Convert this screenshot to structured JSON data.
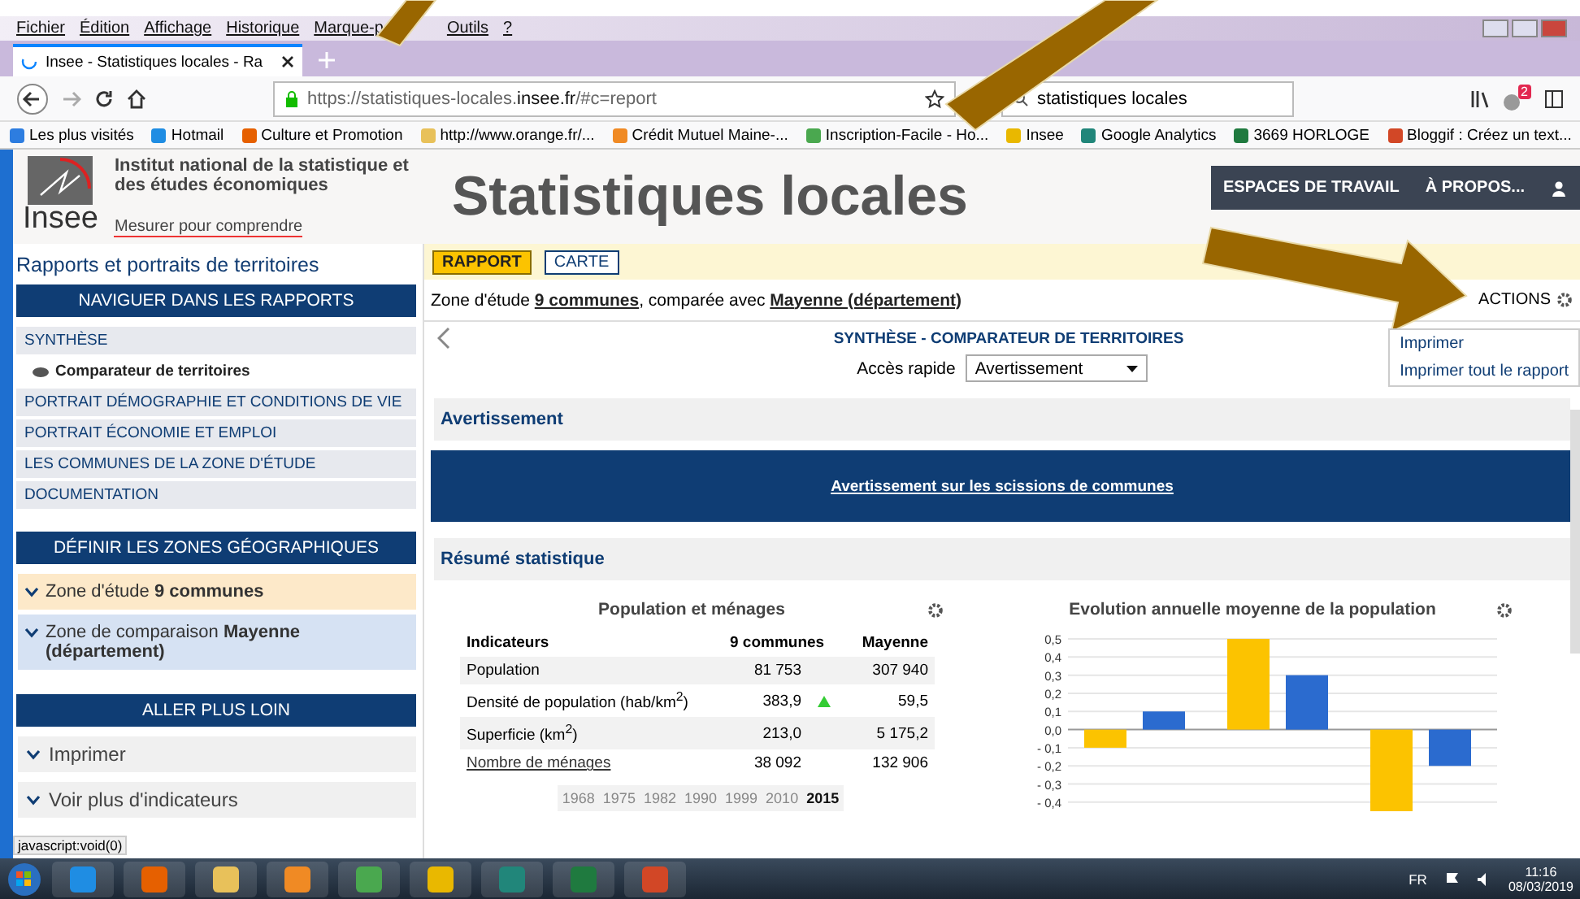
{
  "browser": {
    "menu": [
      "Fichier",
      "Édition",
      "Affichage",
      "Historique",
      "Marque-p",
      "Outils",
      "?"
    ],
    "tab_title": "Insee - Statistiques locales - Ra",
    "url": {
      "prefix": "https://statistiques-locales.",
      "domain": "insee.fr",
      "suffix": "/#c=report"
    },
    "search_value": "statistiques locales",
    "notification_count": "2",
    "bookmarks": [
      "Les plus visités",
      "Hotmail",
      "Culture et Promotion",
      "http://www.orange.fr/...",
      "Crédit Mutuel Maine-...",
      "Inscription-Facile - Ho...",
      "Insee",
      "Google Analytics",
      "3669 HORLOGE",
      "Bloggif : Créez un text..."
    ]
  },
  "header": {
    "logo_text": "Insee",
    "institute": "Institut national de la statistique et des études économiques",
    "tagline": "Mesurer pour comprendre",
    "title": "Statistiques locales",
    "nav": [
      "ESPACES DE TRAVAIL",
      "À PROPOS..."
    ]
  },
  "sidebar": {
    "title": "Rapports et portraits de territoires",
    "sections": [
      {
        "heading": "NAVIGUER DANS LES RAPPORTS",
        "kind": "links",
        "items": [
          {
            "label": "SYNTHÈSE",
            "selected": false,
            "children": [
              {
                "label": "Comparateur de territoires",
                "selected": true
              }
            ]
          },
          {
            "label": "PORTRAIT DÉMOGRAPHIE ET CONDITIONS DE VIE",
            "selected": false
          },
          {
            "label": "PORTRAIT ÉCONOMIE ET EMPLOI",
            "selected": false
          },
          {
            "label": "LES COMMUNES DE LA ZONE D'ÉTUDE",
            "selected": false
          },
          {
            "label": "DOCUMENTATION",
            "selected": false
          }
        ]
      },
      {
        "heading": "DÉFINIR LES ZONES GÉOGRAPHIQUES",
        "kind": "zones",
        "items": [
          {
            "label": "Zone d'étude **9 communes**",
            "color": "#fde9c9"
          },
          {
            "label": "Zone de comparaison **Mayenne (département)**",
            "color": "#d6e2f3"
          }
        ]
      },
      {
        "heading": "ALLER PLUS LOIN",
        "kind": "expanders",
        "items": [
          {
            "label": "Imprimer"
          },
          {
            "label": "Voir plus d'indicateurs"
          }
        ]
      }
    ]
  },
  "content": {
    "modes": [
      {
        "label": "RAPPORT",
        "selected": true
      },
      {
        "label": "CARTE",
        "selected": false
      }
    ],
    "zone_line": {
      "prefix": "Zone d'étude ",
      "study": "9 communes",
      "middle": ", comparée avec ",
      "comparison": "Mayenne (département)"
    },
    "actions": {
      "label": "ACTIONS",
      "menu": [
        "Imprimer",
        "Imprimer tout le rapport"
      ]
    },
    "report_title": "SYNTHÈSE - COMPARATEUR DE TERRITOIRES",
    "quick_access": {
      "label": "Accès rapide",
      "value": "Avertissement"
    },
    "warning": {
      "heading": "Avertissement",
      "link": "Avertissement sur les scissions de communes"
    },
    "summary_heading": "Résumé statistique",
    "table": {
      "title": "Population et ménages",
      "columns": {
        "indicator": "Indicateurs",
        "study": "9 communes",
        "comparison": "Mayenne"
      },
      "rows": [
        {
          "label": "Population",
          "study": "81 753",
          "comparison": "307 940",
          "higher": false,
          "link": false
        },
        {
          "label": "Densité de population (hab/km$^{2}$)",
          "study": "383,9",
          "comparison": "59,5",
          "higher": true,
          "link": false
        },
        {
          "label": "Superficie (km$^{2}$)",
          "study": "213,0",
          "comparison": "5 175,2",
          "higher": false,
          "link": false
        },
        {
          "label": "Nombre de ménages",
          "study": "38 092",
          "comparison": "132 906",
          "higher": false,
          "link": true
        }
      ],
      "years": [
        {
          "label": "1968",
          "selected": false
        },
        {
          "label": "1975",
          "selected": false
        },
        {
          "label": "1982",
          "selected": false
        },
        {
          "label": "1990",
          "selected": false
        },
        {
          "label": "1999",
          "selected": false
        },
        {
          "label": "2010",
          "selected": false
        },
        {
          "label": "2015",
          "selected": true
        }
      ]
    },
    "chart": {
      "title": "Evolution annuelle moyenne de la population",
      "chart_data": {
        "type": "bar",
        "grid": true,
        "ylim": [
          -0.45,
          0.5
        ],
        "yticks": [
          {
            "value": 0.5,
            "label": "0,5"
          },
          {
            "value": 0.4,
            "label": "0,4"
          },
          {
            "value": 0.3,
            "label": "0,3"
          },
          {
            "value": 0.2,
            "label": "0,2"
          },
          {
            "value": 0.1,
            "label": "0,1"
          },
          {
            "value": 0,
            "label": "0,0"
          },
          {
            "value": -0.1,
            "label": "- 0,1"
          },
          {
            "value": -0.2,
            "label": "- 0,2"
          },
          {
            "value": -0.3,
            "label": "- 0,3"
          },
          {
            "value": -0.4,
            "label": "- 0,4"
          }
        ],
        "series": [
          {
            "color": "#fcc300",
            "values": [
              -0.1,
              0.5,
              -0.45
            ]
          },
          {
            "color": "#2b6bcf",
            "values": [
              0.1,
              0.3,
              -0.2
            ]
          }
        ]
      }
    }
  },
  "status_text": "javascript:void(0)",
  "taskbar": {
    "language": "FR",
    "time": "11:16",
    "date": "08/03/2019"
  }
}
